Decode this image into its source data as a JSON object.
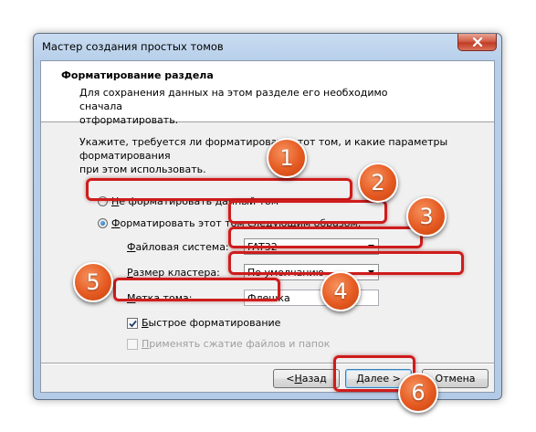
{
  "window": {
    "title": "Мастер создания простых томов"
  },
  "header": {
    "title": "Форматирование раздела",
    "description": "Для сохранения данных на этом разделе его необходимо сначала\nотформатировать."
  },
  "intro": "Укажите, требуется ли форматировать этот том, и какие параметры форматирования\nпри этом использовать.",
  "options": {
    "no_format": {
      "hot": "Н",
      "rest": "е форматировать данный том",
      "checked": false
    },
    "format": {
      "hot": "Ф",
      "rest": "орматировать этот том следующим образом:",
      "checked": true
    }
  },
  "fields": {
    "filesystem": {
      "hot": "Ф",
      "rest": "айловая система:",
      "value": "FAT32"
    },
    "cluster": {
      "hot": "Р",
      "rest": "азмер кластера:",
      "value": "По умолчанию"
    },
    "label": {
      "hot": "М",
      "rest": "етка тома:",
      "value": "Флешка"
    }
  },
  "checkboxes": {
    "quick": {
      "hot": "Б",
      "rest": "ыстрое форматирование",
      "checked": true,
      "enabled": true
    },
    "compress": {
      "hot": "П",
      "rest": "рименять сжатие файлов и папок",
      "checked": false,
      "enabled": false
    }
  },
  "buttons": {
    "back": {
      "hot": "Н",
      "prefix": "< ",
      "rest": "азад"
    },
    "next": {
      "hot": "Д",
      "rest": "алее >"
    },
    "cancel": "Отмена"
  },
  "annotations": [
    "1",
    "2",
    "3",
    "4",
    "5",
    "6"
  ],
  "colors": {
    "highlight": "#cf1c1c",
    "badge": "#e55a21",
    "close": "#c23c24"
  }
}
